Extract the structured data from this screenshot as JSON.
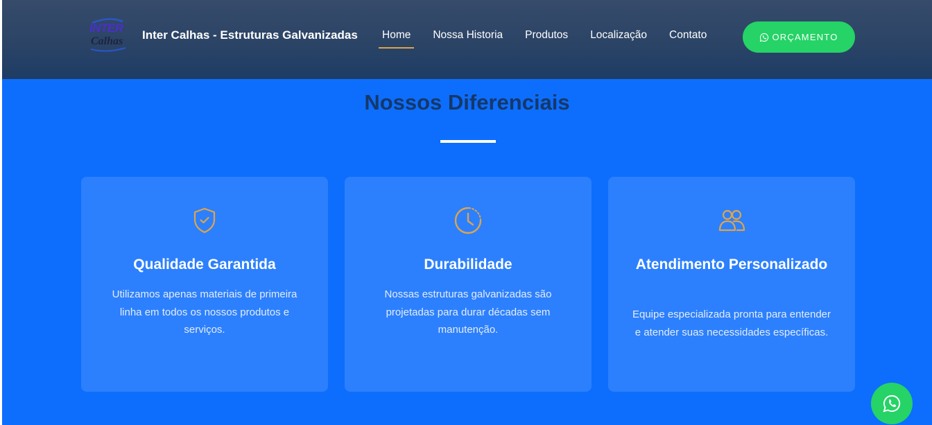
{
  "header": {
    "logo_text_top": "INTER",
    "logo_text_bottom": "Calhas",
    "brand_name": "Inter Calhas - Estruturas Galvanizadas",
    "nav": [
      {
        "label": "Home",
        "active": true
      },
      {
        "label": "Nossa Historia",
        "active": false
      },
      {
        "label": "Produtos",
        "active": false
      },
      {
        "label": "Localização",
        "active": false
      },
      {
        "label": "Contato",
        "active": false
      }
    ],
    "cta_label": "ORÇAMENTO",
    "cta_icon": "whatsapp-icon"
  },
  "section": {
    "title": "Nossos Diferenciais",
    "cards": [
      {
        "icon": "shield-check-icon",
        "title": "Qualidade Garantida",
        "text": "Utilizamos apenas materiais de primeira linha em todos os nossos produtos e serviços."
      },
      {
        "icon": "clock-icon",
        "title": "Durabilidade",
        "text": "Nossas estruturas galvanizadas são projetadas para durar décadas sem manutenção."
      },
      {
        "icon": "users-icon",
        "title": "Atendimento Personalizado",
        "text": "Equipe especializada pronta para entender e atender suas necessidades específicas."
      }
    ]
  },
  "floating_button_icon": "whatsapp-icon",
  "colors": {
    "background": "#0d6efd",
    "card": "#2c80fd",
    "accent": "#e0a44a",
    "whatsapp": "#25d366",
    "title": "#15386b"
  }
}
